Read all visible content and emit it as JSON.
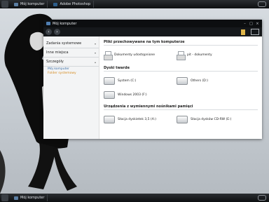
{
  "taskbar_top": {
    "items": [
      "Mój komputer",
      "Adobe Photoshop"
    ]
  },
  "taskbar_bottom": {
    "items": [
      "Mój komputer"
    ]
  },
  "window": {
    "title": "Mój komputer",
    "sidebar": {
      "sections": [
        "Zadania systemowe",
        "Inne miejsca",
        "Szczegóły"
      ],
      "details": {
        "name": "Mój komputer",
        "type": "Folder systemowy"
      }
    },
    "groups": [
      {
        "heading": "Pliki przechowywane na tym komputerze",
        "items": [
          "Dokumenty udostępnione",
          "pit - dokumenty"
        ]
      },
      {
        "heading": "Dyski twarde",
        "items": [
          "System (C:)",
          "Others (D:)",
          "Windows 2003 (F:)"
        ]
      },
      {
        "heading": "Urządzenia z wymiennymi nośnikami pamięci",
        "items": [
          "Stacja dyskietek 3,5 (A:)",
          "Stacja dysków CD-RW (E:)"
        ]
      }
    ]
  },
  "colors": {
    "taskbar": "#0d0f11",
    "titlebar": "#0c0e10",
    "link_blue": "#3b6ea5",
    "link_orange": "#d58a1e"
  }
}
